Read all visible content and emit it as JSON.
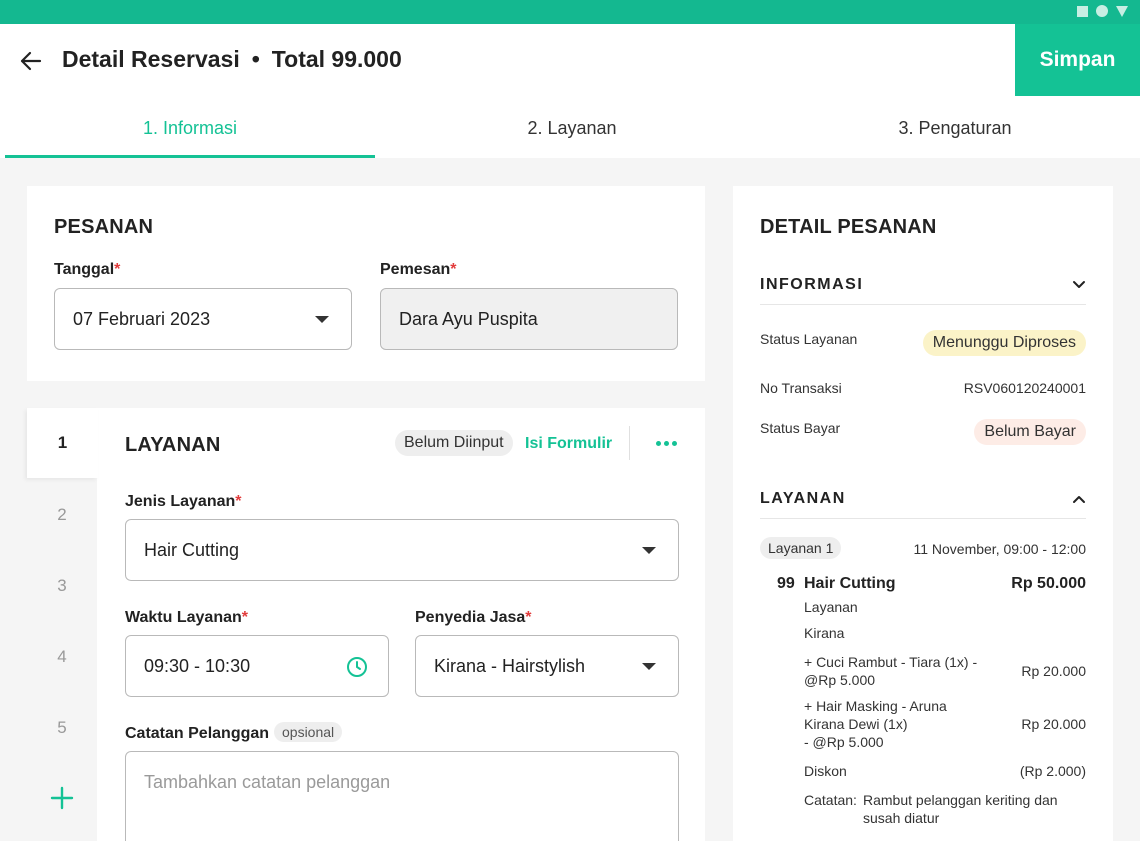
{
  "header": {
    "title": "Detail Reservasi",
    "separator": "•",
    "total": "Total 99.000",
    "save_label": "Simpan"
  },
  "tabs": [
    {
      "label": "1. Informasi",
      "active": true
    },
    {
      "label": "2. Layanan",
      "active": false
    },
    {
      "label": "3.  Pengaturan",
      "active": false
    }
  ],
  "pesanan": {
    "heading": "PESANAN",
    "tanggal_label": "Tanggal",
    "tanggal_value": "07 Februari 2023",
    "pemesan_label": "Pemesan",
    "pemesan_value": "Dara Ayu Puspita",
    "required_mark": "*"
  },
  "layanan_form": {
    "steps": [
      "1",
      "2",
      "3",
      "4",
      "5"
    ],
    "heading": "LAYANAN",
    "status_chip": "Belum Diinput",
    "fill_link": "Isi Formulir",
    "jenis_label": "Jenis Layanan",
    "jenis_value": "Hair Cutting",
    "waktu_label": "Waktu Layanan",
    "waktu_value": "09:30 - 10:30",
    "penyedia_label": "Penyedia Jasa",
    "penyedia_value": "Kirana - Hairstylish",
    "catatan_label": "Catatan Pelanggan",
    "catatan_optional": "opsional",
    "catatan_placeholder": "Tambahkan catatan pelanggan"
  },
  "detail": {
    "heading": "DETAIL PESANAN",
    "informasi": {
      "title": "INFORMASI",
      "status_layanan_label": "Status Layanan",
      "status_layanan_value": "Menunggu Diproses",
      "no_transaksi_label": "No Transaksi",
      "no_transaksi_value": "RSV060120240001",
      "status_bayar_label": "Status Bayar",
      "status_bayar_value": "Belum Bayar"
    },
    "layanan": {
      "title": "LAYANAN",
      "item_chip": "Layanan 1",
      "item_time": "11 November, 09:00 - 12:00",
      "qty": "99",
      "name": "Hair Cutting",
      "price": "Rp 50.000",
      "type": "Layanan",
      "provider": "Kirana",
      "addon1_line1": "+ Cuci Rambut - Tiara (1x) -",
      "addon1_line2": "@Rp 5.000",
      "addon1_price": "Rp 20.000",
      "addon2_line1": "+ Hair Masking - Aruna",
      "addon2_line2": "Kirana Dewi (1x)",
      "addon2_line3": "- @Rp 5.000",
      "addon2_price": "Rp 20.000",
      "diskon_label": "Diskon",
      "diskon_value": "(Rp 2.000)",
      "catatan_label": "Catatan:",
      "catatan_line1": "Rambut pelanggan keriting dan",
      "catatan_line2": "susah diatur"
    }
  },
  "colors": {
    "accent": "#14c295",
    "status_bar": "#14b890",
    "badge_waiting": "#fbf3c8",
    "badge_unpaid": "#fdece6",
    "required": "#e23c3c"
  }
}
